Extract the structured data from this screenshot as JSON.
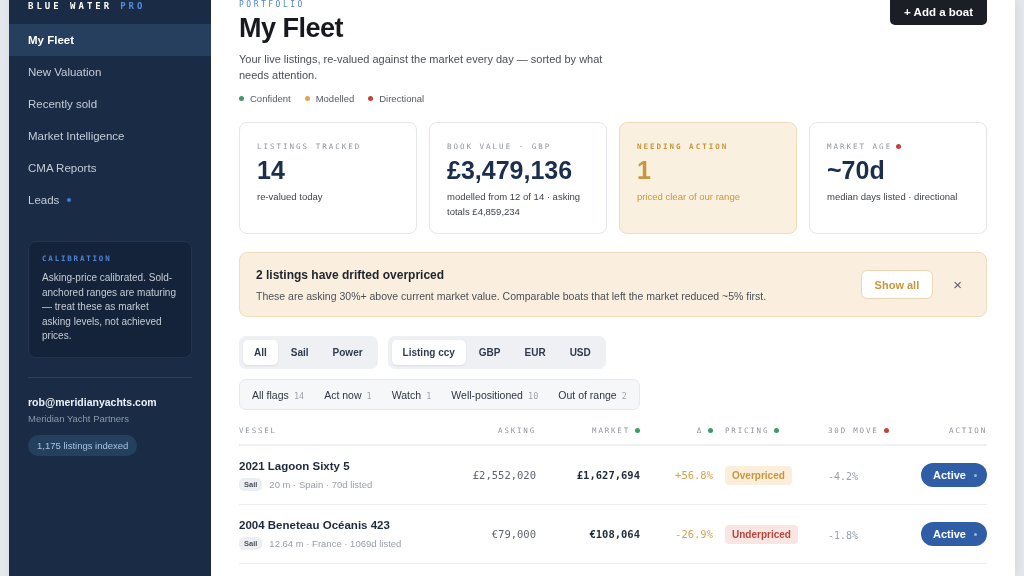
{
  "sidebar": {
    "brand": {
      "name": "BLUE WATER",
      "tag": "PRO"
    },
    "nav": [
      {
        "label": "My Fleet",
        "selected": true,
        "indicator": false
      },
      {
        "label": "New Valuation",
        "selected": false,
        "indicator": false
      },
      {
        "label": "Recently sold",
        "selected": false,
        "indicator": false
      },
      {
        "label": "Market Intelligence",
        "selected": false,
        "indicator": false
      },
      {
        "label": "CMA Reports",
        "selected": false,
        "indicator": false
      },
      {
        "label": "Leads",
        "selected": false,
        "indicator": true
      }
    ],
    "calibration": {
      "label": "CALIBRATION",
      "text": "Asking-price calibrated. Sold-anchored ranges are maturing — treat these as market asking levels, not achieved prices."
    },
    "account": {
      "email": "rob@meridianyachts.com",
      "organization": "Meridian Yacht Partners",
      "badge": "1,175 listings indexed"
    }
  },
  "header": {
    "eyebrow": "PORTFOLIO",
    "title": "My Fleet",
    "subtitle": "Your live listings, re-valued against the market every day — sorted by what needs attention.",
    "action": "+ Add a boat",
    "legend": [
      {
        "label": "Confident",
        "color": "#3f9a63"
      },
      {
        "label": "Modelled",
        "color": "#e3a455"
      },
      {
        "label": "Directional",
        "color": "#c0453a"
      }
    ]
  },
  "stats": [
    {
      "label": "LISTINGS TRACKED",
      "value": "14",
      "note": "re-valued today",
      "kind": "plain"
    },
    {
      "label": "BOOK VALUE · GBP",
      "value": "£3,479,136",
      "note": "modelled from 12 of 14 · asking totals £4,859,234",
      "kind": "plain"
    },
    {
      "label": "NEEDING ACTION",
      "value": "1",
      "note": "priced clear of our range",
      "kind": "attention"
    },
    {
      "label": "MARKET AGE",
      "value": "~70d",
      "note": "median days listed · directional",
      "kind": "plain",
      "color": "#c0453a"
    }
  ],
  "alert": {
    "title": "2 listings have drifted overpriced",
    "text": "These are asking 30%+ above current market value. Comparable boats that left the market reduced ~5% first.",
    "button": "Show all",
    "close": "×"
  },
  "filters": {
    "type": [
      {
        "label": "All",
        "selected": true
      },
      {
        "label": "Sail",
        "selected": false
      },
      {
        "label": "Power",
        "selected": false
      }
    ],
    "currency": [
      {
        "label": "Listing ccy",
        "selected": true
      },
      {
        "label": "GBP",
        "selected": false
      },
      {
        "label": "EUR",
        "selected": false
      },
      {
        "label": "USD",
        "selected": false
      }
    ],
    "flags": [
      {
        "label": "All flags",
        "count": "14"
      },
      {
        "label": "Act now",
        "count": "1"
      },
      {
        "label": "Watch",
        "count": "1"
      },
      {
        "label": "Well-positioned",
        "count": "10"
      },
      {
        "label": "Out of range",
        "count": "2"
      }
    ]
  },
  "table": {
    "columns": [
      {
        "label": "VESSEL"
      },
      {
        "label": "ASKING"
      },
      {
        "label": "MARKET",
        "color": "#3f9a63"
      },
      {
        "label": "Δ",
        "color": "#3f9a63"
      },
      {
        "label": "PRICING",
        "color": "#3f9a63"
      },
      {
        "label": "30D MOVE",
        "color": "#c0453a"
      },
      {
        "label": "ACTION"
      }
    ],
    "rows": [
      {
        "vessel": "2021 Lagoon Sixty 5",
        "tag": "Sail",
        "meta": "20 m · Spain · 70d listed",
        "asking": "£2,552,020",
        "market": "£1,627,694",
        "delta": "+56.8%",
        "pricing": {
          "label": "Overpriced",
          "kind": "over"
        },
        "move": "-4.2%",
        "action": "Active"
      },
      {
        "vessel": "2004 Beneteau Océanis 423",
        "tag": "Sail",
        "meta": "12.64 m · France · 1069d listed",
        "asking": "€79,000",
        "market": "€108,064",
        "delta": "-26.9%",
        "pricing": {
          "label": "Underpriced",
          "kind": "under"
        },
        "move": "-1.8%",
        "action": "Active"
      }
    ]
  }
}
